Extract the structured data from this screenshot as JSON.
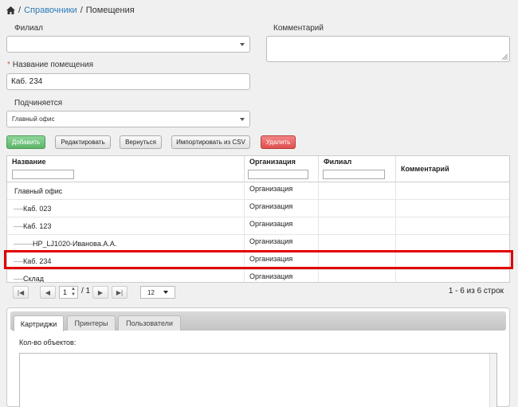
{
  "breadcrumb": {
    "sep1": "/",
    "link": "Справочники",
    "sep2": "/",
    "current": "Помещения"
  },
  "form": {
    "branch_label": "Филиал",
    "comment_label": "Комментарий",
    "room_name_label": "Название помещения",
    "room_name_value": "Каб. 234",
    "parent_label": "Подчиняется",
    "parent_value": "Главный офис"
  },
  "toolbar": {
    "add": "Добавить",
    "edit": "Редактировать",
    "back": "Вернуться",
    "import": "Импортировать из CSV",
    "delete": "Удалить"
  },
  "grid": {
    "columns": [
      "Название",
      "Организация",
      "Филиал",
      "Комментарий"
    ],
    "rows": [
      {
        "name": "Главный офис",
        "org": "Организация",
        "level": 0
      },
      {
        "name": "Каб. 023",
        "org": "Организация",
        "level": 1
      },
      {
        "name": "Каб. 123",
        "org": "Организация",
        "level": 1
      },
      {
        "name": "HP_LJ1020-Иванова.А.А.",
        "org": "Организация",
        "level": 2
      },
      {
        "name": "Каб. 234",
        "org": "Организация",
        "level": 1
      },
      {
        "name": "Склад",
        "org": "Организация",
        "level": 1
      }
    ]
  },
  "pager": {
    "page": "1",
    "of": "/ 1",
    "page_size": "12",
    "summary": "1 - 6 из 6 строк"
  },
  "tabs": {
    "cartridges": "Картриджи",
    "printers": "Принтеры",
    "users": "Пользователи"
  },
  "details": {
    "count_label": "Кол-во объектов:"
  },
  "colors": {
    "highlight": "#e00000",
    "link": "#2a7ab8"
  }
}
